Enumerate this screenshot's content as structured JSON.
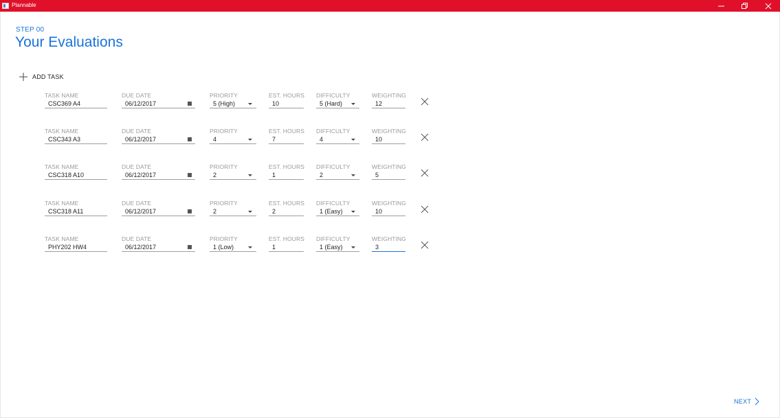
{
  "window": {
    "title": "Plannable",
    "accent_color": "#e0102a",
    "controls": [
      "minimize-icon",
      "restore-icon",
      "close-icon"
    ]
  },
  "header": {
    "step": "STEP 00",
    "title": "Your Evaluations"
  },
  "toolbar": {
    "add_task_label": "ADD TASK",
    "add_icon": "plus-icon"
  },
  "labels": {
    "task_name": "TASK NAME",
    "due_date": "DUE DATE",
    "priority": "PRIORITY",
    "est_hours": "EST. HOURS",
    "difficulty": "DIFFICULTY",
    "weighting": "WEIGHTING"
  },
  "tasks": [
    {
      "task_name": "CSC369 A4",
      "due_date": "06/12/2017",
      "priority": "5 (High)",
      "est_hours": "10",
      "difficulty": "5 (Hard)",
      "weighting": "12"
    },
    {
      "task_name": "CSC343 A3",
      "due_date": "06/12/2017",
      "priority": "4",
      "est_hours": "7",
      "difficulty": "4",
      "weighting": "10"
    },
    {
      "task_name": "CSC318 A10",
      "due_date": "06/12/2017",
      "priority": "2",
      "est_hours": "1",
      "difficulty": "2",
      "weighting": "5"
    },
    {
      "task_name": "CSC318 A11",
      "due_date": "06/12/2017",
      "priority": "2",
      "est_hours": "2",
      "difficulty": "1 (Easy)",
      "weighting": "10"
    },
    {
      "task_name": "PHY202 HW4",
      "due_date": "06/12/2017",
      "priority": "1 (Low)",
      "est_hours": "1",
      "difficulty": "1 (Easy)",
      "weighting": "3"
    }
  ],
  "focused_field": "weighting of last task",
  "footer": {
    "next_label": "NEXT",
    "next_icon": "chevron-right-icon",
    "link_color": "#1a73d9"
  }
}
